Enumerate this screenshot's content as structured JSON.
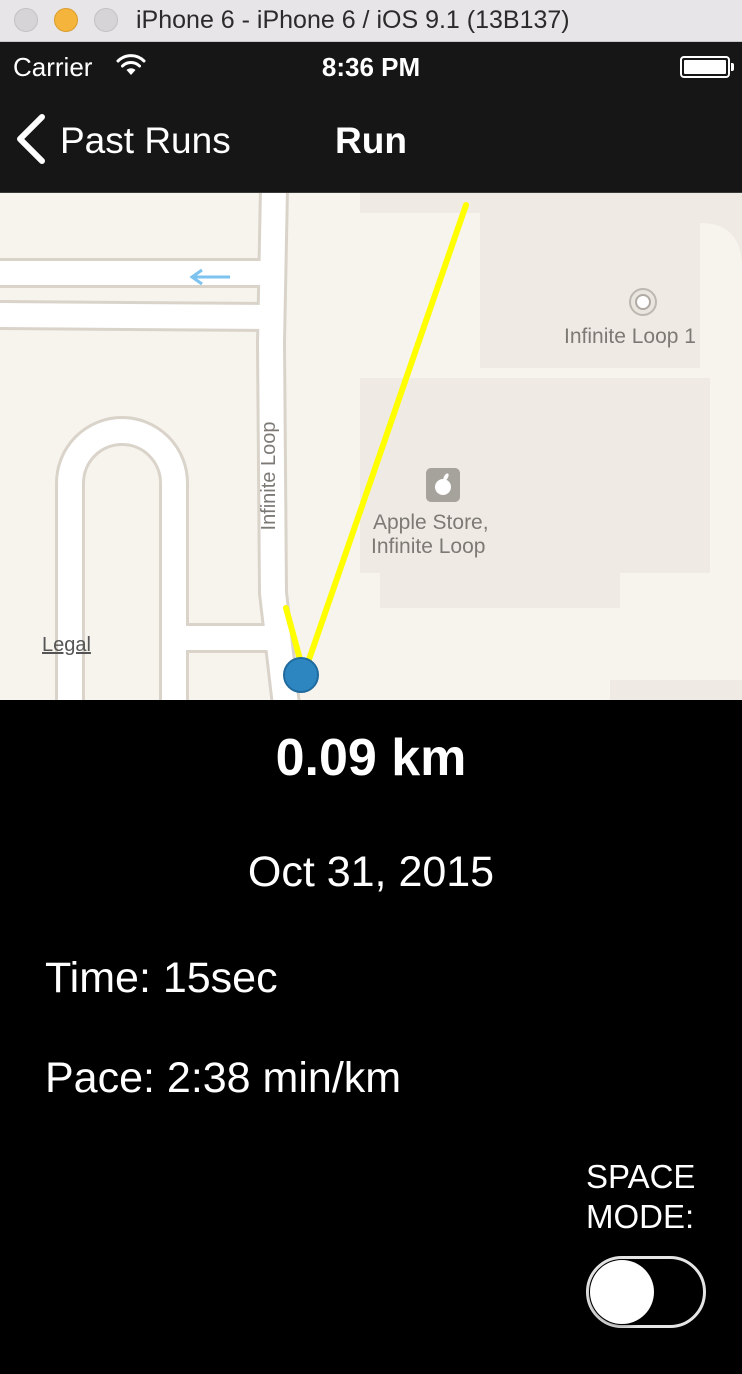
{
  "window": {
    "title": "iPhone 6 - iPhone 6 / iOS 9.1 (13B137)"
  },
  "status_bar": {
    "carrier": "Carrier",
    "time": "8:36 PM",
    "icons": [
      "wifi-icon",
      "battery-icon"
    ]
  },
  "nav_bar": {
    "back_label": "Past Runs",
    "title": "Run",
    "back_icon": "chevron-left-icon"
  },
  "map": {
    "labels": {
      "street": "Infinite Loop",
      "poi": "Infinite Loop 1",
      "store_line1": "Apple Store,",
      "store_line2": "Infinite Loop"
    },
    "legal": "Legal",
    "route_color": "#ffff00",
    "location_color": "#2e86c1",
    "icons": [
      "apple-store-icon",
      "poi-pin-icon",
      "direction-arrow-icon"
    ]
  },
  "run": {
    "distance": "0.09 km",
    "date": "Oct 31, 2015",
    "time": "Time: 15sec",
    "pace": "Pace: 2:38 min/km"
  },
  "space_mode": {
    "label_line1": "SPACE",
    "label_line2": "MODE:",
    "on": false
  }
}
